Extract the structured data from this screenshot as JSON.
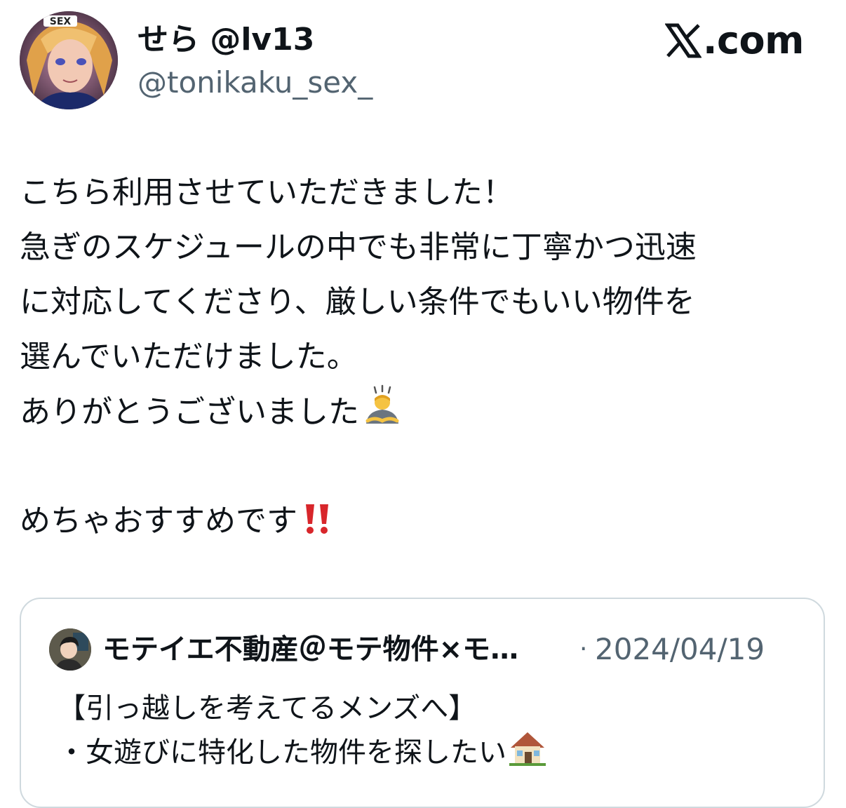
{
  "header": {
    "display_name": "せら @lv13",
    "handle": "@tonikaku_sex_",
    "avatar_badge": "SEX",
    "brand": {
      "icon": "x-logo-icon",
      "text": ".com"
    }
  },
  "tweet": {
    "lines": [
      "こちら利用させていただきました！",
      "急ぎのスケジュールの中でも非常に丁寧かつ迅速",
      "に対応してくださり、厳しい条件でもいい物件を",
      "選んでいただけました。",
      "ありがとうございました",
      "",
      "めちゃおすすめです"
    ],
    "emoji": {
      "bow": "person-bowing-emoji",
      "exclamation": "double-exclamation-emoji"
    }
  },
  "quote": {
    "author": "モテイエ不動産＠モテ物件×モ…",
    "separator": "·",
    "date": "2024/04/19",
    "lines": [
      "【引っ越しを考えてるメンズへ】",
      "・女遊びに特化した物件を探したい"
    ],
    "emoji": "house-emoji"
  },
  "colors": {
    "text_primary": "#0f1419",
    "text_secondary": "#536471",
    "border": "#cfd9de",
    "exclamation_red": "#d8262b"
  }
}
